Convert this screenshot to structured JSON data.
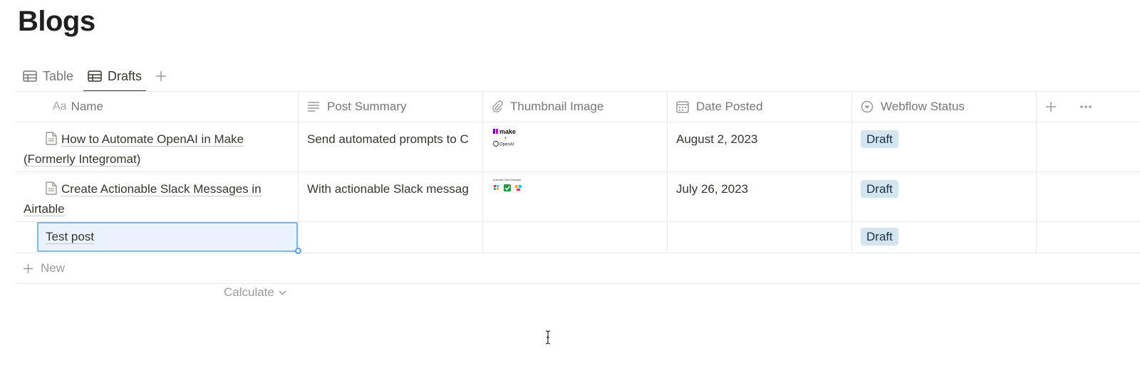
{
  "page": {
    "title": "Blogs"
  },
  "tabs": [
    {
      "label": "Table",
      "icon": "table-icon",
      "active": false
    },
    {
      "label": "Drafts",
      "icon": "table-icon",
      "active": true
    }
  ],
  "columns": [
    {
      "label": "Name",
      "type_glyph": "Aa",
      "icon": "text-type-icon"
    },
    {
      "label": "Post Summary",
      "icon": "lines-icon"
    },
    {
      "label": "Thumbnail Image",
      "icon": "paperclip-icon"
    },
    {
      "label": "Date Posted",
      "icon": "calendar-icon"
    },
    {
      "label": "Webflow Status",
      "icon": "status-icon"
    }
  ],
  "rows": [
    {
      "name": "How to Automate OpenAI in Make",
      "name_line2": "(Formerly Integromat)",
      "summary": "Send automated prompts to C",
      "thumbnail": {
        "logo_top": "make",
        "logo_bottom": "OpenAI"
      },
      "date": "August 2, 2023",
      "status": "Draft"
    },
    {
      "name": "Create Actionable Slack Messages in",
      "name_line2": "Airtable",
      "summary": "With actionable Slack messag",
      "thumbnail": {
        "caption": "Actionable Slack Messages"
      },
      "date": "July 26, 2023",
      "status": "Draft"
    },
    {
      "name": "Test post",
      "summary": "",
      "date": "",
      "status": "Draft"
    }
  ],
  "footer": {
    "new_label": "New",
    "calculate_label": "Calculate"
  },
  "colors": {
    "badge_bg": "#d3e5ef",
    "badge_text": "#183347",
    "selection_border": "#7fb6e3",
    "selection_bg": "#eaf3fb"
  }
}
